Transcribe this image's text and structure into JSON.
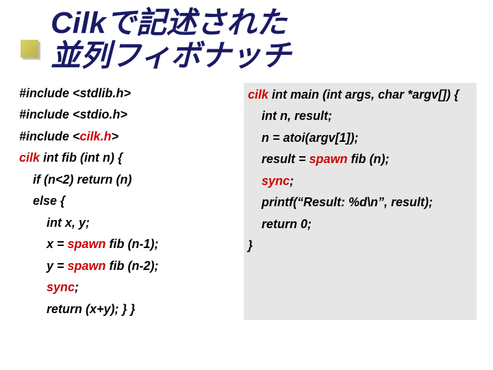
{
  "title_line1": "Cilkで記述された",
  "title_line2": "並列フィボナッチ",
  "kw": {
    "cilk": "cilk",
    "spawn": "spawn",
    "sync": "sync"
  },
  "left": {
    "l1": "#include <stdlib.h>",
    "l2": "#include <stdio.h>",
    "l3a": "#include <",
    "l3b": "cilk.h",
    "l3c": ">",
    "l4b": " int fib (int n) {",
    "l5": "if (n<2) return (n)",
    "l6": "else {",
    "l7": "int x, y;",
    "l8a": "x = ",
    "l8b": " fib (n-1);",
    "l9a": "y = ",
    "l9b": " fib (n-2);",
    "l10": ";",
    "l11": "return (x+y); } }"
  },
  "right": {
    "r1b": " int main (int args, char *argv[]) {",
    "r2": "int n, result;",
    "r3": "n = atoi(argv[1]);",
    "r4a": "result = ",
    "r4b": " fib (n);",
    "r5": ";",
    "r6": "printf(“Result: %d\\n”, result);",
    "r7": "return 0;",
    "r8": "}"
  }
}
